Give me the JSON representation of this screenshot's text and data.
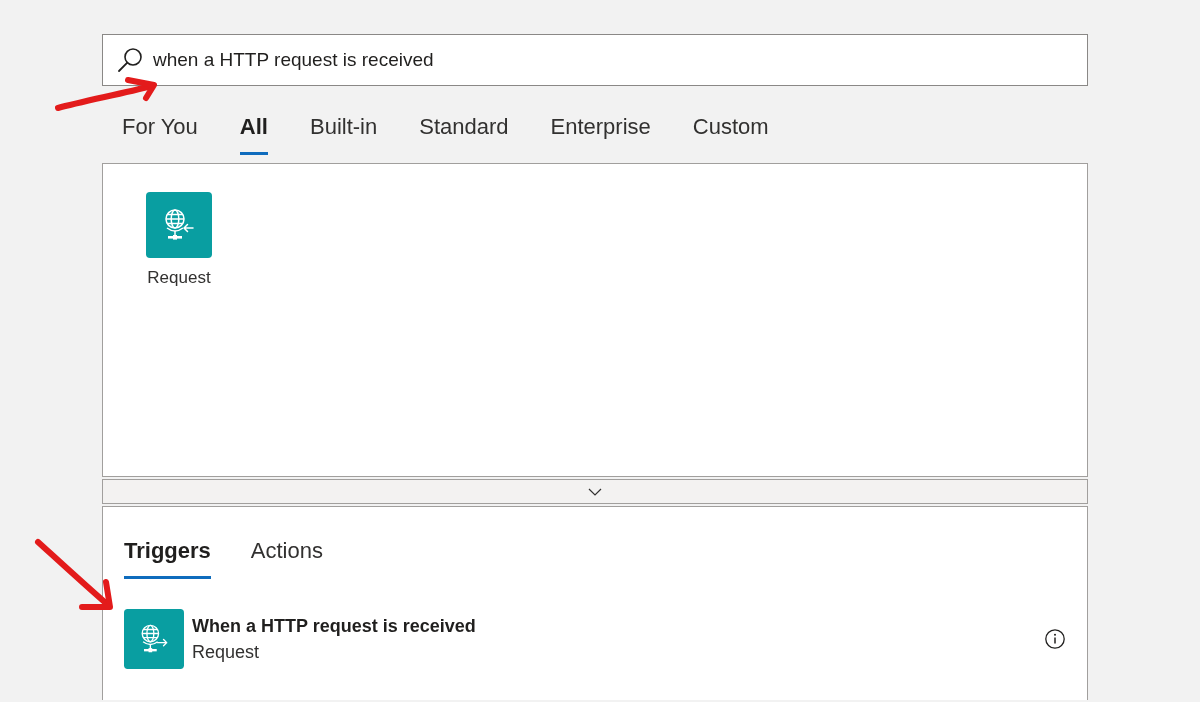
{
  "search": {
    "value": "when a HTTP request is received"
  },
  "category_tabs": [
    {
      "label": "For You",
      "selected": false
    },
    {
      "label": "All",
      "selected": true
    },
    {
      "label": "Built-in",
      "selected": false
    },
    {
      "label": "Standard",
      "selected": false
    },
    {
      "label": "Enterprise",
      "selected": false
    },
    {
      "label": "Custom",
      "selected": false
    }
  ],
  "connectors": [
    {
      "name": "Request"
    }
  ],
  "operation_tabs": [
    {
      "label": "Triggers",
      "selected": true
    },
    {
      "label": "Actions",
      "selected": false
    }
  ],
  "operations": [
    {
      "title": "When a HTTP request is received",
      "connector": "Request"
    }
  ],
  "annotations": [
    {
      "kind": "arrow"
    },
    {
      "kind": "arrow"
    }
  ]
}
